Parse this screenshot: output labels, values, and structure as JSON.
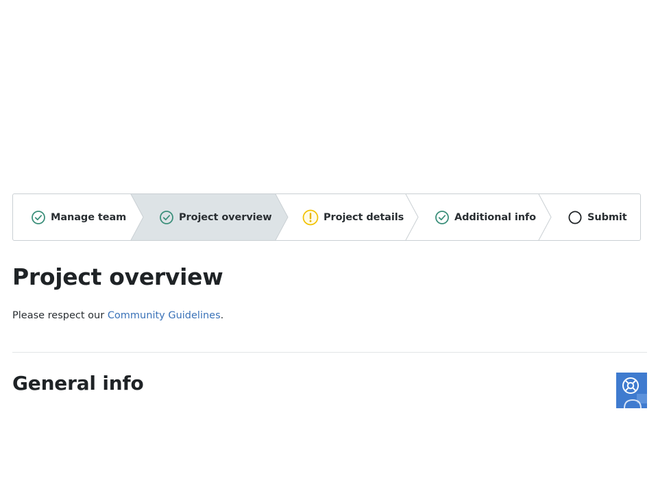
{
  "stepper": {
    "steps": [
      {
        "label": "Manage team",
        "status": "complete",
        "icon": "check-circle-icon"
      },
      {
        "label": "Project overview",
        "status": "current-complete",
        "icon": "check-circle-icon"
      },
      {
        "label": "Project details",
        "status": "warning",
        "icon": "exclamation-circle-icon"
      },
      {
        "label": "Additional info",
        "status": "complete",
        "icon": "check-circle-icon"
      },
      {
        "label": "Submit",
        "status": "not-started",
        "icon": "empty-circle-icon"
      }
    ]
  },
  "page": {
    "title": "Project overview",
    "intro_prefix": "Please respect our ",
    "intro_link": "Community Guidelines",
    "intro_suffix": "."
  },
  "section": {
    "title": "General info"
  },
  "colors": {
    "check": "#3b8f7a",
    "warning": "#f2c200",
    "current_bg": "#dde3e6",
    "link": "#3a72b8",
    "widget": "#3f7bcf"
  }
}
